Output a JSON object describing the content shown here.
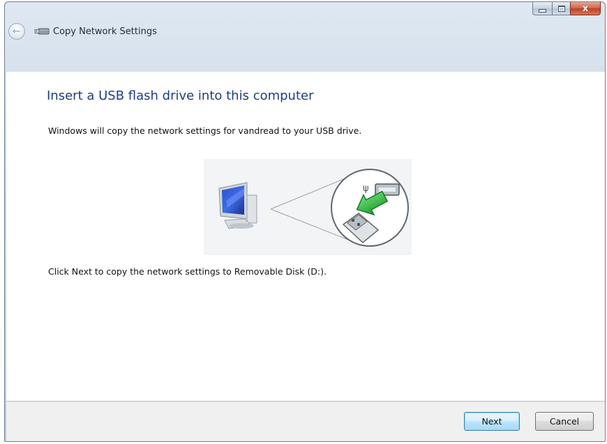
{
  "window": {
    "title": "Copy Network Settings",
    "caption_buttons": {
      "minimize_icon": "minimize-icon",
      "maximize_icon": "maximize-icon",
      "close_icon": "close-icon",
      "close_glyph": "x"
    }
  },
  "header": {
    "back_icon": "back-arrow-icon",
    "back_glyph": "←",
    "title_icon": "usb-drive-icon"
  },
  "main": {
    "instruction": "Insert a USB flash drive into this computer",
    "description": "Windows will copy the network settings for vandread to your USB drive.",
    "illustration": "computer-to-usb-illustration",
    "click_instruction": "Click Next to copy the network settings to Removable Disk (D:)."
  },
  "footer": {
    "next_label": "Next",
    "cancel_label": "Cancel"
  },
  "colors": {
    "instruction": "#1e3c87",
    "close_button": "#c44a2e",
    "arrow_green": "#2aa83a"
  }
}
